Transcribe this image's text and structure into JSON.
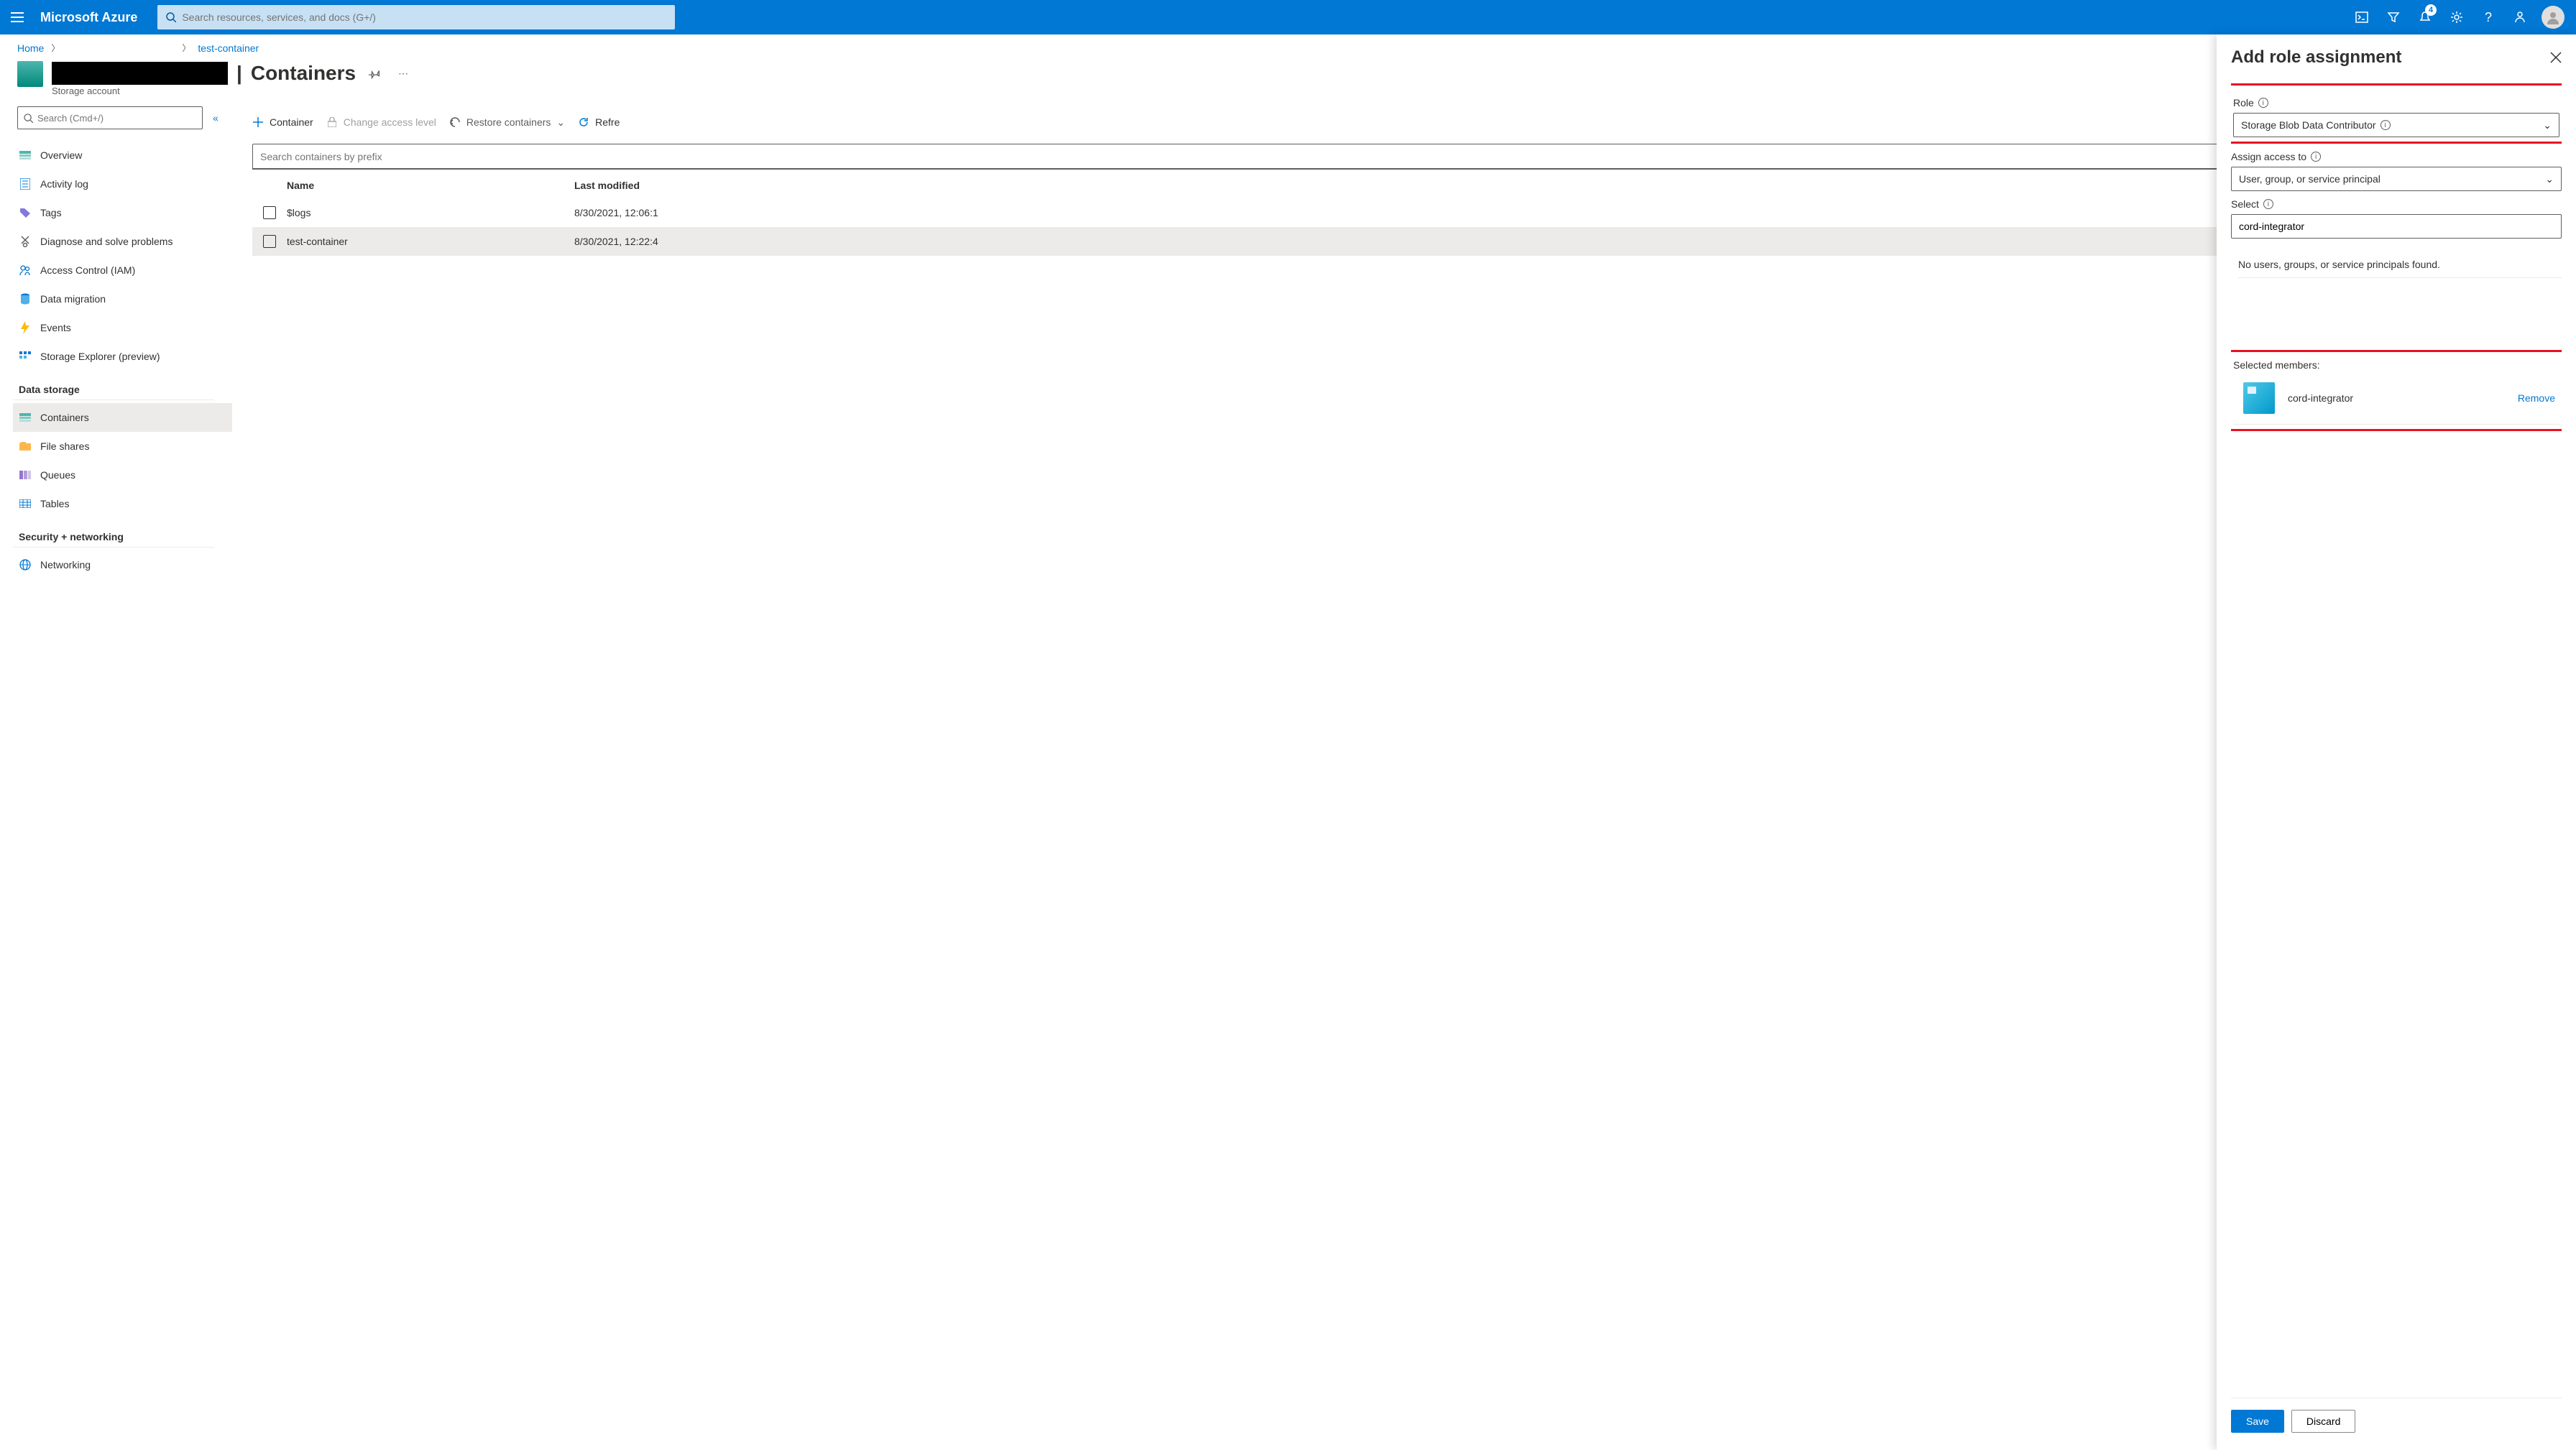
{
  "topbar": {
    "brand": "Microsoft Azure",
    "search_placeholder": "Search resources, services, and docs (G+/)",
    "notification_count": "4"
  },
  "breadcrumb": {
    "home": "Home",
    "current": "test-container"
  },
  "resource": {
    "title": "Containers",
    "subtype": "Storage account"
  },
  "sidebar": {
    "search_placeholder": "Search (Cmd+/)",
    "items_top": [
      {
        "label": "Overview"
      },
      {
        "label": "Activity log"
      },
      {
        "label": "Tags"
      },
      {
        "label": "Diagnose and solve problems"
      },
      {
        "label": "Access Control (IAM)"
      },
      {
        "label": "Data migration"
      },
      {
        "label": "Events"
      },
      {
        "label": "Storage Explorer (preview)"
      }
    ],
    "group_data_storage": "Data storage",
    "items_storage": [
      {
        "label": "Containers"
      },
      {
        "label": "File shares"
      },
      {
        "label": "Queues"
      },
      {
        "label": "Tables"
      }
    ],
    "group_security": "Security + networking",
    "items_security": [
      {
        "label": "Networking"
      }
    ]
  },
  "toolbar": {
    "add": "Container",
    "change_level": "Change access level",
    "restore": "Restore containers",
    "refresh": "Refre"
  },
  "filter": {
    "placeholder": "Search containers by prefix"
  },
  "table": {
    "headers": {
      "name": "Name",
      "modified": "Last modified"
    },
    "rows": [
      {
        "name": "$logs",
        "modified": "8/30/2021, 12:06:1"
      },
      {
        "name": "test-container",
        "modified": "8/30/2021, 12:22:4"
      }
    ]
  },
  "panel": {
    "title": "Add role assignment",
    "role_label": "Role",
    "role_value": "Storage Blob Data Contributor",
    "assign_label": "Assign access to",
    "assign_value": "User, group, or service principal",
    "select_label": "Select",
    "select_value": "cord-integrator",
    "no_results": "No users, groups, or service principals found.",
    "selected_members_label": "Selected members:",
    "member_name": "cord-integrator",
    "remove": "Remove",
    "save": "Save",
    "discard": "Discard"
  }
}
